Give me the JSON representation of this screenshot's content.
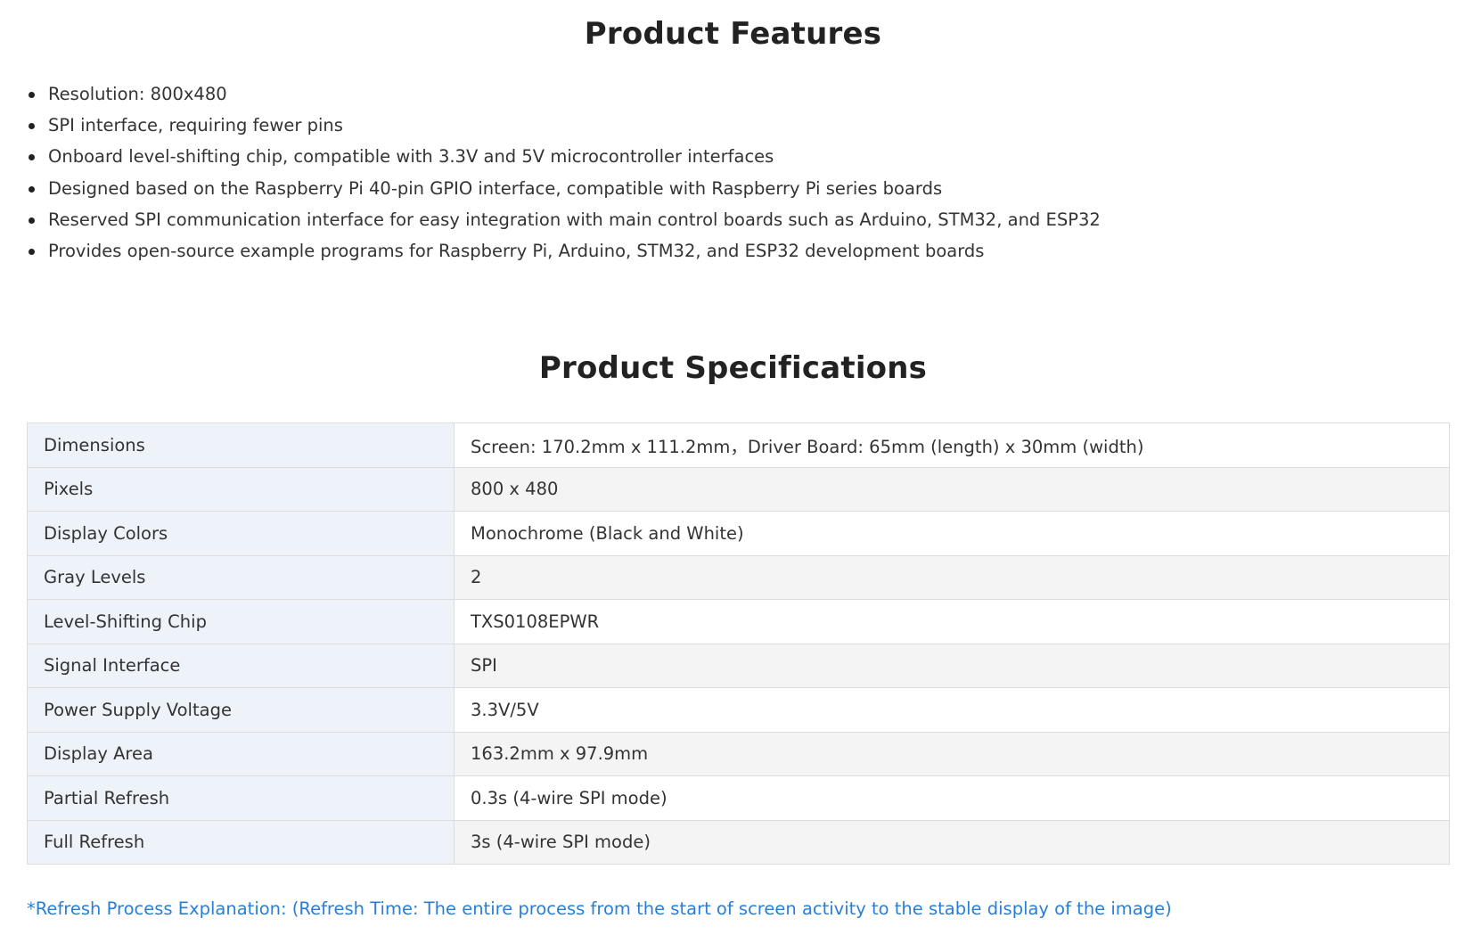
{
  "features": {
    "title": "Product Features",
    "items": [
      "Resolution: 800x480",
      "SPI interface, requiring fewer pins",
      "Onboard level-shifting chip, compatible with 3.3V and 5V microcontroller interfaces",
      "Designed based on the Raspberry Pi 40-pin GPIO interface, compatible with Raspberry Pi series boards",
      "Reserved SPI communication interface for easy integration with main control boards such as Arduino, STM32, and ESP32",
      "Provides open-source example programs for Raspberry Pi, Arduino, STM32, and ESP32 development boards"
    ]
  },
  "specifications": {
    "title": "Product Specifications",
    "rows": [
      {
        "label": "Dimensions",
        "value": "Screen: 170.2mm x 111.2mm，Driver Board: 65mm (length) x 30mm (width)"
      },
      {
        "label": "Pixels",
        "value": "800 x 480"
      },
      {
        "label": "Display Colors",
        "value": "Monochrome (Black and White)"
      },
      {
        "label": "Gray Levels",
        "value": "2"
      },
      {
        "label": "Level-Shifting Chip",
        "value": "TXS0108EPWR"
      },
      {
        "label": "Signal Interface",
        "value": "SPI"
      },
      {
        "label": "Power Supply Voltage",
        "value": "3.3V/5V"
      },
      {
        "label": "Display Area",
        "value": "163.2mm x 97.9mm"
      },
      {
        "label": "Partial Refresh",
        "value": "0.3s (4-wire SPI mode)"
      },
      {
        "label": "Full Refresh",
        "value": "3s (4-wire SPI mode)"
      }
    ]
  },
  "note": {
    "text": "*Refresh Process Explanation: (Refresh Time: The entire process from the start of screen activity to the stable display of the image)"
  },
  "colors": {
    "text": "#333333",
    "heading": "#222222",
    "label_cell_bg": "#eef3fa",
    "striped_row_bg": "#f4f4f4",
    "border": "#dcdcdc",
    "note_link": "#2a7fd4"
  }
}
